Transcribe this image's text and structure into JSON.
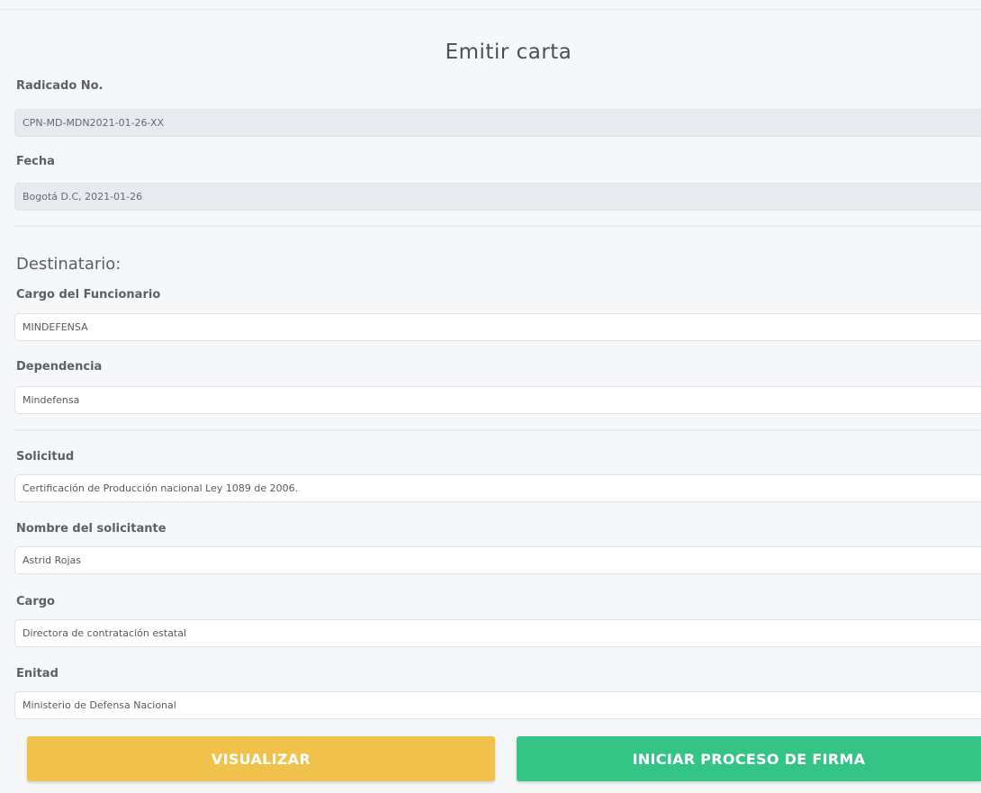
{
  "form": {
    "title": "Emitir carta",
    "radicado": {
      "label": "Radicado No.",
      "value": "CPN-MD-MDN2021-01-26-XX"
    },
    "fecha": {
      "label": "Fecha",
      "value": "Bogotá D.C, 2021-01-26"
    },
    "destinatario": {
      "heading": "Destinatario:",
      "cargo_funcionario": {
        "label": "Cargo del Funcionario",
        "value": "MINDEFENSA"
      },
      "dependencia": {
        "label": "Dependencia",
        "value": "Mindefensa"
      }
    },
    "solicitud": {
      "label": "Solicitud",
      "value": "Certificación de Producción nacional Ley 1089 de 2006."
    },
    "nombre_solicitante": {
      "label": "Nombre del solicitante",
      "value": "Astrid Rojas"
    },
    "cargo": {
      "label": "Cargo",
      "value": "Directora de contratación estatal"
    },
    "entidad": {
      "label": "Enitad",
      "value": "Ministerio de Defensa Nacional"
    }
  },
  "actions": {
    "visualizar_label": "VISUALIZAR",
    "firma_label": "INICIAR PROCESO DE FIRMA"
  },
  "colors": {
    "visualizar": "#f0c24b",
    "firma": "#33c486",
    "readonly_field": "#e8eaef",
    "page_background": "#f6f7f9"
  }
}
